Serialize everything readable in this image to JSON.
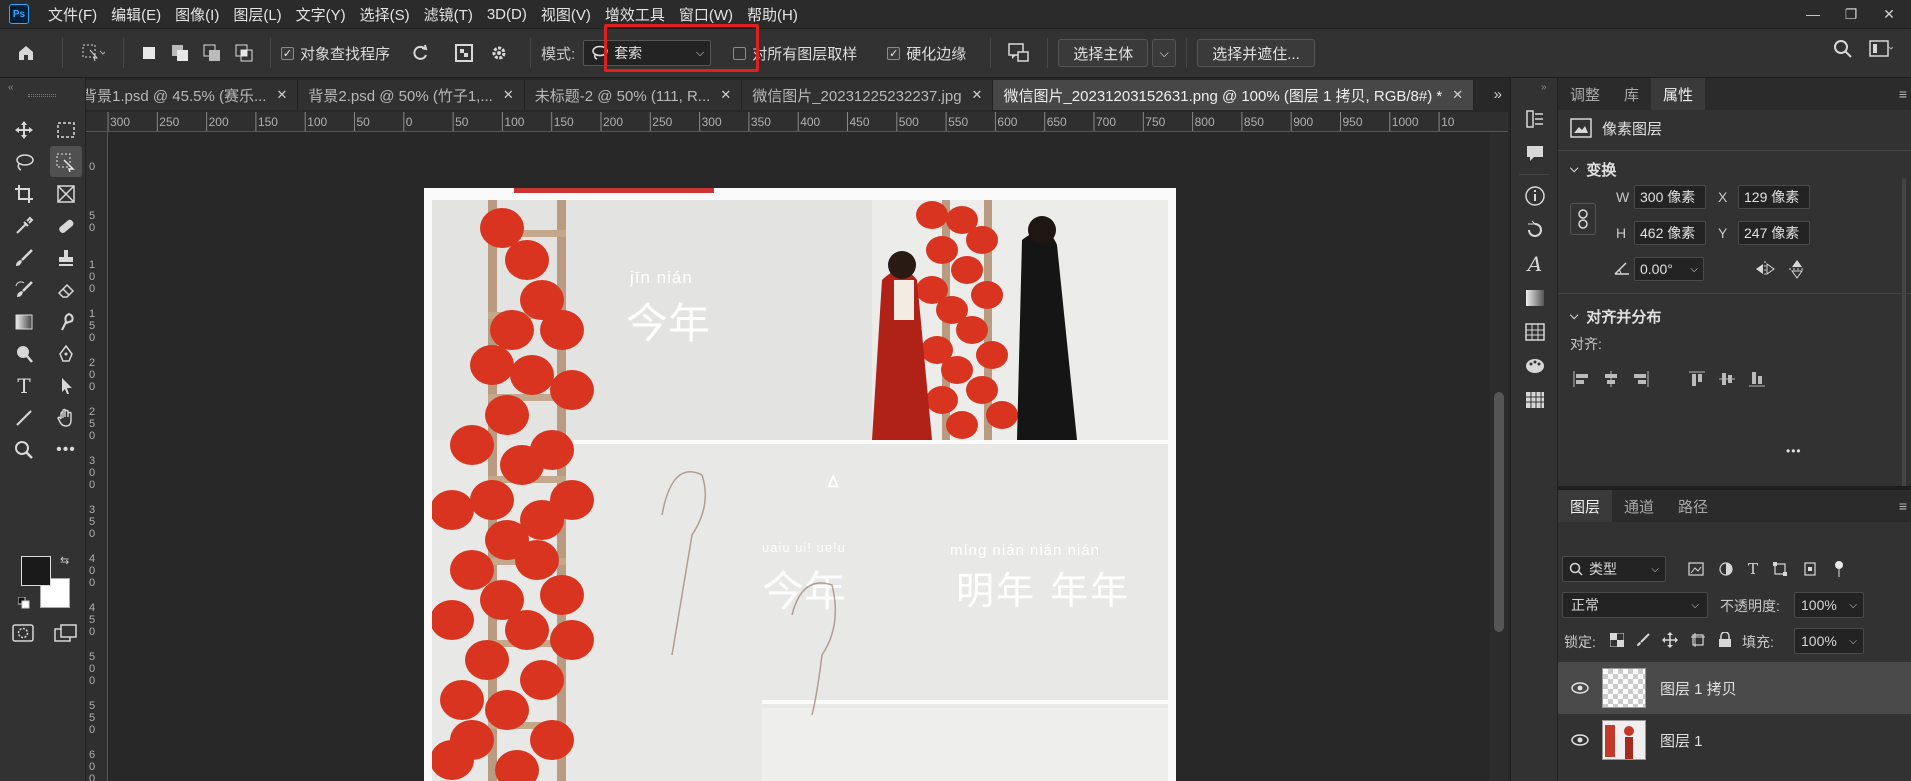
{
  "app": {
    "logo": "Ps"
  },
  "menu": [
    "文件(F)",
    "编辑(E)",
    "图像(I)",
    "图层(L)",
    "文字(Y)",
    "选择(S)",
    "滤镜(T)",
    "3D(D)",
    "视图(V)",
    "增效工具",
    "窗口(W)",
    "帮助(H)"
  ],
  "window_controls": {
    "minimize": "—",
    "restore": "❐",
    "close": "✕"
  },
  "options": {
    "object_finder": {
      "label": "对象查找程序",
      "checked": true
    },
    "mode_label": "模式:",
    "mode_value": "套索",
    "sample_all_layers": {
      "label": "对所有图层取样",
      "checked": false
    },
    "harden_edges": {
      "label": "硬化边缘",
      "checked": true
    },
    "select_subject": "选择主体",
    "select_and_mask": "选择并遮住..."
  },
  "tabs": [
    {
      "label": "背景1.psd @ 45.5% (赛乐...",
      "active": false
    },
    {
      "label": "背景2.psd @ 50% (竹子1,...",
      "active": false
    },
    {
      "label": "未标题-2 @ 50% (111, R...",
      "active": false
    },
    {
      "label": "微信图片_20231225232237.jpg",
      "active": false
    },
    {
      "label": "微信图片_20231203152631.png @ 100% (图层 1 拷贝, RGB/8#) *",
      "active": true
    }
  ],
  "ruler": {
    "top_labels": [
      "300",
      "250",
      "200",
      "150",
      "100",
      "50",
      "0",
      "50",
      "100",
      "150",
      "200",
      "250",
      "300",
      "350",
      "400",
      "450",
      "500",
      "550",
      "600",
      "650",
      "700",
      "750",
      "800",
      "850",
      "900",
      "950",
      "1000",
      "10"
    ],
    "left_labels": [
      "5",
      "0",
      "5 0",
      "1 0 0",
      "1 5 0",
      "2 0 0",
      "2 5 0",
      "3 0 0",
      "3 5 0",
      "4 0 0",
      "4 5 0",
      "5 0 0",
      "5 5 0",
      "6 0 0"
    ]
  },
  "canvas": {
    "pinyin_1": "jīn nián",
    "title_1": "今年",
    "pinyin_2": "míng nián  nián nián",
    "title_2": "明年 年年",
    "ghost_text": "今年",
    "ghost_pinyin": "uaiu  ui!  uɐ!u"
  },
  "properties_panel": {
    "tabs": [
      {
        "label": "调整",
        "active": false
      },
      {
        "label": "库",
        "active": false
      },
      {
        "label": "属性",
        "active": true
      }
    ],
    "layer_type": "像素图层",
    "transform_title": "变换",
    "w_label": "W",
    "w_value": "300 像素",
    "h_label": "H",
    "h_value": "462 像素",
    "x_label": "X",
    "x_value": "129 像素",
    "y_label": "Y",
    "y_value": "247 像素",
    "angle_value": "0.00°",
    "align_title": "对齐并分布",
    "align_label": "对齐:",
    "more": "•••"
  },
  "layers_panel": {
    "tabs": [
      {
        "label": "图层",
        "active": true
      },
      {
        "label": "通道",
        "active": false
      },
      {
        "label": "路径",
        "active": false
      }
    ],
    "filter_kind": "类型",
    "blend_mode": "正常",
    "opacity_label": "不透明度:",
    "opacity_value": "100%",
    "lock_label": "锁定:",
    "fill_label": "填充:",
    "fill_value": "100%",
    "layers": [
      {
        "name": "图层 1 拷贝",
        "selected": true
      },
      {
        "name": "图层 1",
        "selected": false
      }
    ]
  },
  "colors": {
    "highlight_box": "#e0201f",
    "accent": "#31a8ff",
    "lantern": "#d9341f"
  }
}
